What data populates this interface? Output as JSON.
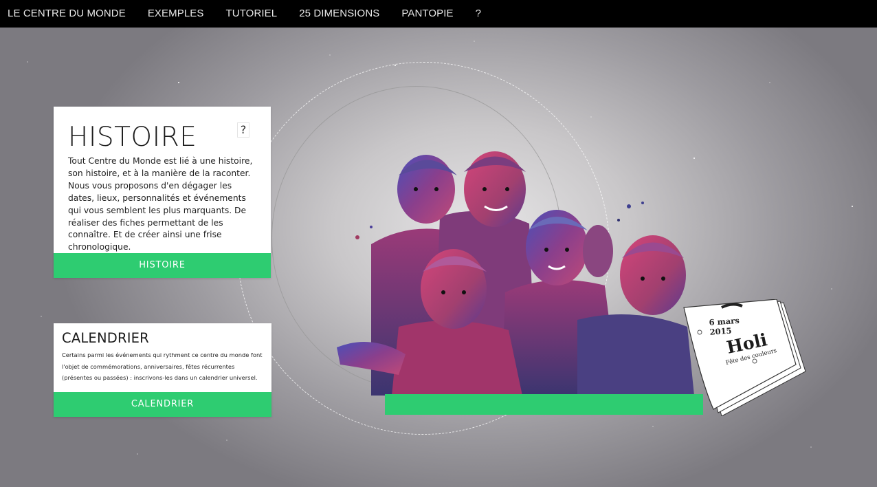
{
  "nav": {
    "items": [
      "LE CENTRE DU MONDE",
      "EXEMPLES",
      "TUTORIEL",
      "25 DIMENSIONS",
      "PANTOPIE",
      "?"
    ]
  },
  "histoire": {
    "title": "HISTOIRE",
    "help": "?",
    "text": "Tout Centre du Monde est lié à une histoire, son histoire, et à la manière de la raconter. Nous vous proposons d'en dégager les dates, lieux, personnalités et événements qui vous semblent les plus marquants. De réaliser des fiches permettant de les connaître. Et de créer ainsi une frise chronologique.",
    "button": "HISTOIRE"
  },
  "calendrier": {
    "title": "CALENDRIER",
    "text": "Certains parmi les événements qui rythment ce centre du monde font l'objet de commémorations, anniversaires, fêtes récurrentes (présentes ou passées) : inscrivons-les dans un calendrier universel.",
    "button": "CALENDRIER"
  },
  "calendar_page": {
    "date": "6 mars 2015",
    "title": "Holi",
    "subtitle": "Fête des couleurs"
  },
  "colors": {
    "accent": "#2ecc71",
    "nav_bg": "#000000"
  }
}
